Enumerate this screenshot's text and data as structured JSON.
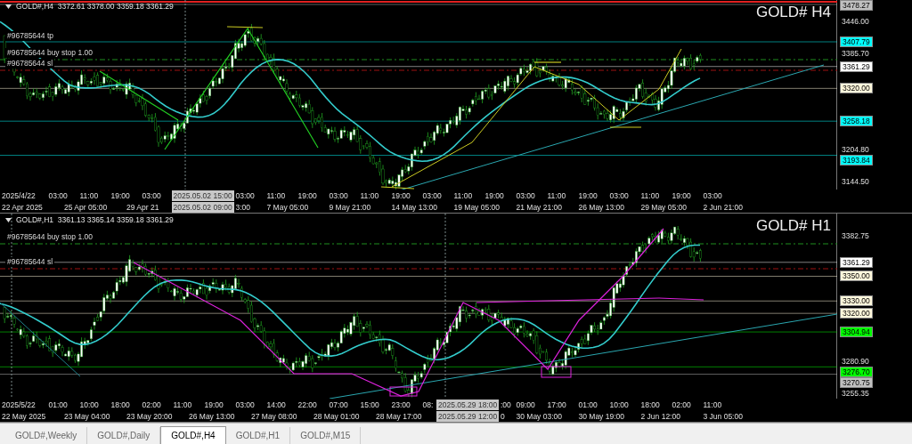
{
  "panes": [
    {
      "header": "GOLD#,H4  3372.61 3378.00 3359.18 3361.29",
      "title": "GOLD# H4",
      "orders": [
        {
          "kind": "tp",
          "text": "#96785644 tp"
        },
        {
          "kind": "buy_stop",
          "text": "#96785644 buy stop 1.00"
        },
        {
          "kind": "sl",
          "text": "#96785644 sl"
        }
      ],
      "price_axis": [
        {
          "text": "3478.27",
          "color": "#c0c0c0"
        },
        {
          "text": "3446.00"
        },
        {
          "text": "3407.79",
          "color": "#00ffff"
        },
        {
          "text": "3385.70"
        },
        {
          "text": "3361.29",
          "color": "#ffffff"
        },
        {
          "text": "3320.00",
          "color": "#fff8dc"
        },
        {
          "text": "3258.18",
          "color": "#00ffff"
        },
        {
          "text": "3204.80"
        },
        {
          "text": "3193.84",
          "color": "#00ffff"
        },
        {
          "text": "3144.50"
        }
      ],
      "time_axis": {
        "row_1": [
          {
            "kind": "tick",
            "text": "2025/4/22"
          },
          {
            "kind": "tick",
            "text": "03:00"
          },
          {
            "kind": "tick",
            "text": "11:00"
          },
          {
            "kind": "tick",
            "text": "19:00"
          },
          {
            "kind": "tick",
            "text": "03:00"
          },
          {
            "kind": "crosshair",
            "text": "2025.05.02 15:00"
          },
          {
            "kind": "tick",
            "text": "03:00"
          },
          {
            "kind": "tick",
            "text": "11:00"
          },
          {
            "kind": "tick",
            "text": "19:00"
          },
          {
            "kind": "tick",
            "text": "03:00"
          },
          {
            "kind": "tick",
            "text": "11:00"
          },
          {
            "kind": "tick",
            "text": "19:00"
          },
          {
            "kind": "tick",
            "text": "03:00"
          },
          {
            "kind": "tick",
            "text": "11:00"
          },
          {
            "kind": "tick",
            "text": "19:00"
          },
          {
            "kind": "tick",
            "text": "03:00"
          },
          {
            "kind": "tick",
            "text": "11:00"
          },
          {
            "kind": "tick",
            "text": "19:00"
          },
          {
            "kind": "tick",
            "text": "03:00"
          },
          {
            "kind": "tick",
            "text": "11:00"
          },
          {
            "kind": "tick",
            "text": "19:00"
          },
          {
            "kind": "tick",
            "text": "03:00"
          }
        ],
        "row_2": [
          {
            "kind": "tick",
            "text": "22 Apr 2025"
          },
          {
            "kind": "tick",
            "text": "25 Apr 05:00"
          },
          {
            "kind": "fragment",
            "text": "29 Apr 21"
          },
          {
            "kind": "crosshair",
            "text": "2025.05.02 09:00"
          },
          {
            "kind": "fragment",
            "text": "3:00"
          },
          {
            "kind": "tick",
            "text": "7 May 05:00"
          },
          {
            "kind": "tick",
            "text": "9 May 21:00"
          },
          {
            "kind": "tick",
            "text": "14 May 13:00"
          },
          {
            "kind": "tick",
            "text": "19 May 05:00"
          },
          {
            "kind": "tick",
            "text": "21 May 21:00"
          },
          {
            "kind": "tick",
            "text": "26 May 13:00"
          },
          {
            "kind": "tick",
            "text": "29 May 05:00"
          },
          {
            "kind": "tick",
            "text": "2 Jun 21:00"
          }
        ]
      }
    },
    {
      "header": "GOLD#,H1  3361.13 3365.14 3359.18 3361.29",
      "title": "GOLD# H1",
      "orders": [
        {
          "kind": "buy_stop",
          "text": "#96785644 buy stop 1.00"
        },
        {
          "kind": "sl",
          "text": "#96785644 sl"
        }
      ],
      "price_axis": [
        {
          "text": "3382.75"
        },
        {
          "text": "3361.29",
          "color": "#ffffff"
        },
        {
          "text": "3350.00",
          "color": "#fff8dc"
        },
        {
          "text": "3330.00",
          "color": "#fff8dc"
        },
        {
          "text": "3320.00",
          "color": "#fff8dc"
        },
        {
          "text": "3304.94",
          "color": "#00ff00"
        },
        {
          "text": "3280.90"
        },
        {
          "text": "3276.70",
          "color": "#00ff00"
        },
        {
          "text": "3270.75",
          "color": "#c0c0c0"
        },
        {
          "text": "3255.35"
        }
      ],
      "time_axis": {
        "row_1": [
          {
            "kind": "tick",
            "text": "2025/5/22"
          },
          {
            "kind": "tick",
            "text": "01:00"
          },
          {
            "kind": "tick",
            "text": "10:00"
          },
          {
            "kind": "tick",
            "text": "18:00"
          },
          {
            "kind": "tick",
            "text": "02:00"
          },
          {
            "kind": "tick",
            "text": "11:00"
          },
          {
            "kind": "tick",
            "text": "19:00"
          },
          {
            "kind": "tick",
            "text": "03:00"
          },
          {
            "kind": "tick",
            "text": "14:00"
          },
          {
            "kind": "tick",
            "text": "22:00"
          },
          {
            "kind": "tick",
            "text": "07:00"
          },
          {
            "kind": "tick",
            "text": "15:00"
          },
          {
            "kind": "tick",
            "text": "23:00"
          },
          {
            "kind": "fragment",
            "text": "08:"
          },
          {
            "kind": "crosshair",
            "text": "2025.05.29 18:00"
          },
          {
            "kind": "fragment",
            "text": ":00"
          },
          {
            "kind": "tick",
            "text": "09:00"
          },
          {
            "kind": "tick",
            "text": "17:00"
          },
          {
            "kind": "tick",
            "text": "01:00"
          },
          {
            "kind": "tick",
            "text": "10:00"
          },
          {
            "kind": "tick",
            "text": "18:00"
          },
          {
            "kind": "tick",
            "text": "02:00"
          },
          {
            "kind": "tick",
            "text": "11:00"
          }
        ],
        "row_2": [
          {
            "kind": "tick",
            "text": "22 May 2025"
          },
          {
            "kind": "tick",
            "text": "23 May 04:00"
          },
          {
            "kind": "tick",
            "text": "23 May 20:00"
          },
          {
            "kind": "tick",
            "text": "26 May 13:00"
          },
          {
            "kind": "tick",
            "text": "27 May 08:00"
          },
          {
            "kind": "tick",
            "text": "28 May 01:00"
          },
          {
            "kind": "tick",
            "text": "28 May 17:00"
          },
          {
            "kind": "crosshair",
            "text": "2025.05.29 12:00"
          },
          {
            "kind": "fragment",
            "text": "0"
          },
          {
            "kind": "tick",
            "text": "30 May 03:00"
          },
          {
            "kind": "tick",
            "text": "30 May 19:00"
          },
          {
            "kind": "tick",
            "text": "2 Jun 12:00"
          },
          {
            "kind": "tick",
            "text": "3 Jun 05:00"
          }
        ]
      }
    }
  ],
  "tabs": [
    {
      "label": "GOLD#,Weekly",
      "selected": false
    },
    {
      "label": "GOLD#,Daily",
      "selected": false
    },
    {
      "label": "GOLD#,H4",
      "selected": true
    },
    {
      "label": "GOLD#,H1",
      "selected": false
    },
    {
      "label": "GOLD#,M15",
      "selected": false
    }
  ]
}
